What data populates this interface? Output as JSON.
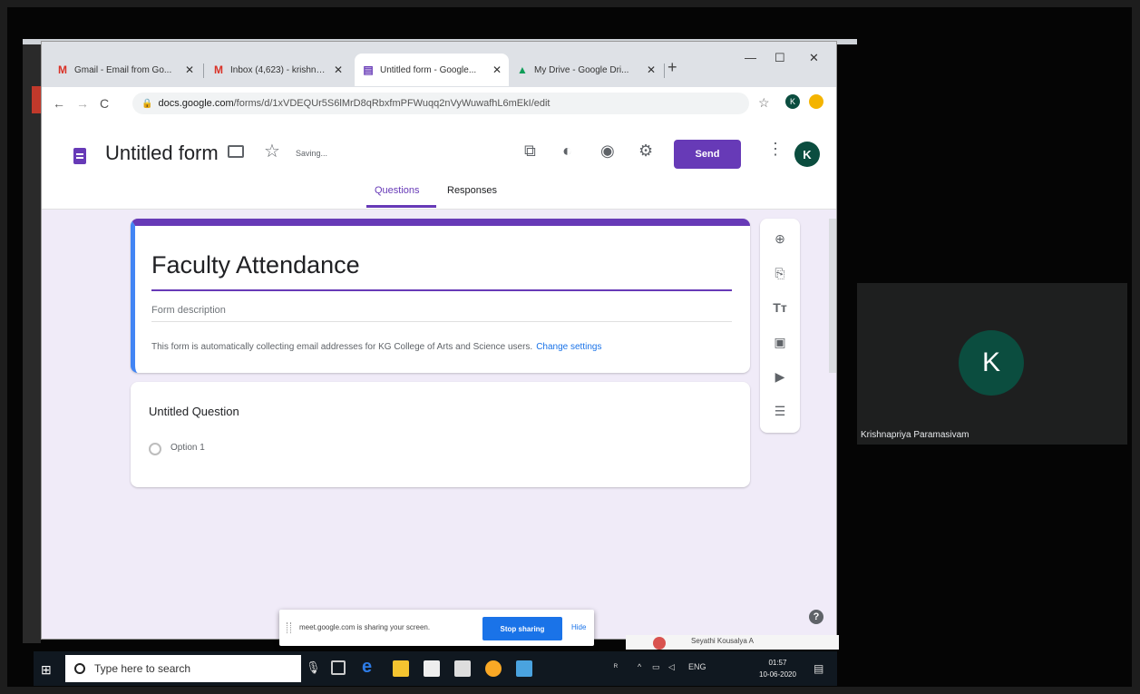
{
  "browser": {
    "tabs": [
      {
        "icon": "M",
        "title": "Gmail - Email from Go..."
      },
      {
        "icon": "M",
        "title": "Inbox (4,623) - krishna..."
      },
      {
        "icon": "▤",
        "title": "Untitled form - Google..."
      },
      {
        "icon": "▲",
        "title": "My Drive - Google Dri..."
      }
    ],
    "new_tab": "+",
    "url_host": "docs.google.com",
    "url_path": "/forms/d/1xVDEQUr5S6lMrD8qRbxfmPFWuqq2nVyWuwafhL6mEkI/edit",
    "profile_initial": "K"
  },
  "forms": {
    "doc_title": "Untitled form",
    "saving": "Saving...",
    "send": "Send",
    "avatar": "K",
    "tabs": [
      "Questions",
      "Responses"
    ],
    "form_title": "Faculty Attendance",
    "form_description": "Form description",
    "notice": "This form is automatically collecting email addresses for KG College of Arts and Science users.",
    "notice_link": "Change settings",
    "question_title": "Untitled Question",
    "option": "Option 1",
    "toolbar_icons": [
      "add-question-icon",
      "import-questions-icon",
      "add-title-icon",
      "add-image-icon",
      "add-video-icon",
      "add-section-icon"
    ]
  },
  "screen_share": {
    "message": "meet.google.com is sharing your screen.",
    "stop": "Stop sharing",
    "hide": "Hide"
  },
  "taskbar": {
    "search_placeholder": "Type here to search",
    "lang": "ENG",
    "time": "01:57",
    "date": "10-06-2020"
  },
  "meeting": {
    "participant_initial": "K",
    "participant_name": "Krishnapriya Paramasivam",
    "speaker_label": "Seyathi Kousalya A"
  },
  "colors": {
    "accent": "#673ab7",
    "canvas": "#f0ebf8",
    "link": "#1a73e8",
    "avatar": "#0b4d3f"
  }
}
